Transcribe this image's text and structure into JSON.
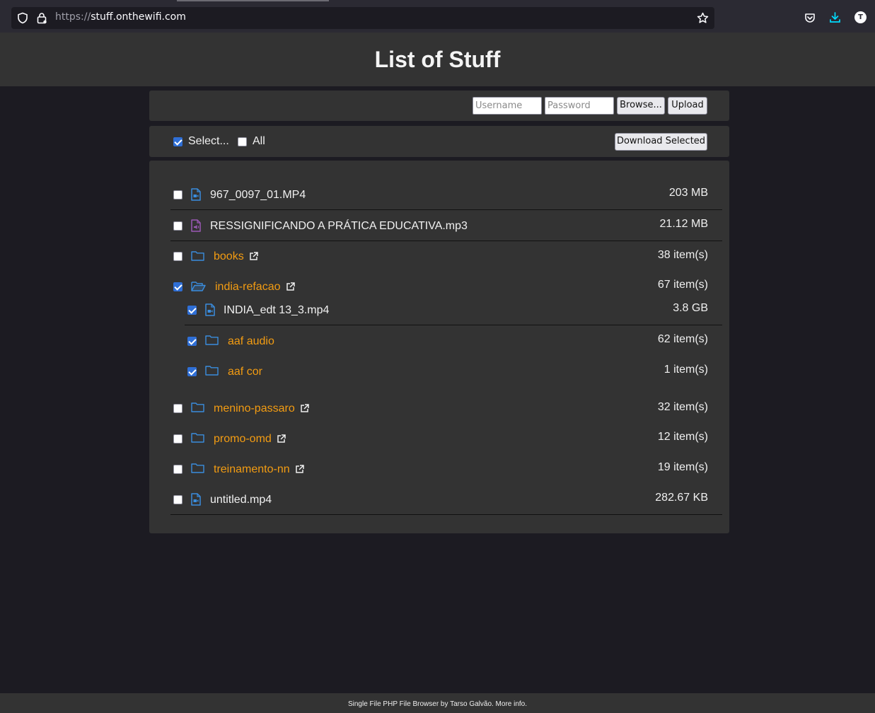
{
  "browser": {
    "url_scheme": "https://",
    "url_host": "stuff.onthewifi.com",
    "avatar_initial": "T"
  },
  "header": {
    "title": "List of Stuff"
  },
  "upload_form": {
    "username_placeholder": "Username",
    "password_placeholder": "Password",
    "browse_label": "Browse...",
    "upload_label": "Upload"
  },
  "select_bar": {
    "select_label": "Select...",
    "select_checked": true,
    "all_label": "All",
    "all_checked": false,
    "download_label": "Download Selected"
  },
  "items": [
    {
      "name": "967_0097_01.MP4",
      "type": "video-file",
      "size": "203 MB",
      "checked": false
    },
    {
      "name": "RESSIGNIFICANDO A PRÁTICA EDUCATIVA.mp3",
      "type": "audio-file",
      "size": "21.12 MB",
      "checked": false
    },
    {
      "name": "books",
      "type": "folder",
      "size": "38 item(s)",
      "checked": false
    },
    {
      "name": "india-refacao",
      "type": "folder-open",
      "size": "67 item(s)",
      "checked": true,
      "children": [
        {
          "name": "INDIA_edt 13_3.mp4",
          "type": "video-file",
          "size": "3.8 GB",
          "checked": true
        },
        {
          "name": "aaf audio",
          "type": "folder",
          "size": "62 item(s)",
          "checked": true
        },
        {
          "name": "aaf cor",
          "type": "folder",
          "size": "1 item(s)",
          "checked": true
        }
      ]
    },
    {
      "name": "menino-passaro",
      "type": "folder",
      "size": "32 item(s)",
      "checked": false
    },
    {
      "name": "promo-omd",
      "type": "folder",
      "size": "12 item(s)",
      "checked": false
    },
    {
      "name": "treinamento-nn",
      "type": "folder",
      "size": "19 item(s)",
      "checked": false
    },
    {
      "name": "untitled.mp4",
      "type": "video-file",
      "size": "282.67 KB",
      "checked": false
    }
  ],
  "footer": {
    "text": "Single File PHP File Browser by Tarso Galvão. More info."
  },
  "colors": {
    "folder_link": "#f39c12",
    "icon_blue": "#3a8dde",
    "icon_purple": "#9b59b6",
    "checkbox_on": "#2f6fd6"
  }
}
